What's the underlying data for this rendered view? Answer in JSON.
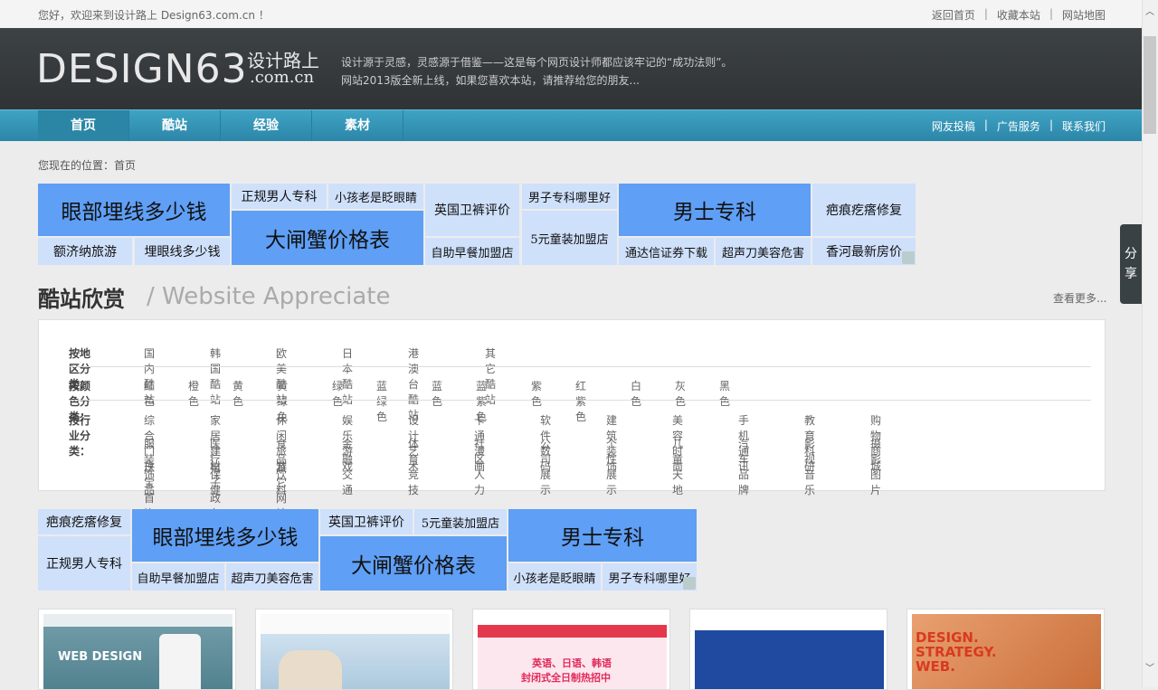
{
  "top": {
    "welcome": "您好，欢迎来到设计路上 Design63.com.cn ！",
    "links": [
      "返回首页",
      "收藏本站",
      "网站地图"
    ],
    "sep": "|"
  },
  "header": {
    "logo_main": "DESIGN63",
    "logo_cn": "设计路上",
    "logo_domain": ".com.cn",
    "slogan1": "设计源于灵感，灵感源于借鉴——这是每个网页设计师都应该牢记的“成功法则”。",
    "slogan2": "网站2013版全新上线，如果您喜欢本站，请推荐给您的朋友..."
  },
  "nav": {
    "items": [
      "首页",
      "酷站",
      "经验",
      "素材"
    ],
    "right": [
      "网友投稿",
      "广告服务",
      "联系我们"
    ]
  },
  "breadcrumb": "您现在的位置：首页",
  "ads1": {
    "a1": "眼部埋线多少钱",
    "a2": "额济纳旅游",
    "a3": "埋眼线多少钱",
    "a4": "正规男人专科",
    "a5": "小孩老是眨眼睛",
    "a6": "大闸蟹价格表",
    "a7": "英国卫裤评价",
    "a8": "自助早餐加盟店",
    "a9": "男子专科哪里好",
    "a10": "5元童装加盟店",
    "a11": "男士专科",
    "a12": "通达信证券下载",
    "a13": "超声刀美容危害",
    "a14": "疤痕疙瘩修复",
    "a15": "香河最新房价"
  },
  "section": {
    "title": "酷站欣赏",
    "subtitle": "/ Website Appreciate",
    "more": "查看更多..."
  },
  "categories": {
    "region_label": "按地区分类：",
    "region": [
      "国内酷站",
      "韩国酷站",
      "欧美酷站",
      "日本酷站",
      "港澳台酷站",
      "其它酷站"
    ],
    "color_label": "按颜色分类：",
    "color": [
      "红色",
      "橙色",
      "黄色",
      "黄绿色",
      "绿色",
      "蓝绿色",
      "蓝色",
      "蓝紫色",
      "紫色",
      "红紫色",
      "白色",
      "灰色",
      "黑色"
    ],
    "industry_label": "按行业分类：",
    "industry_row1": [
      "综合门户",
      "家居建材",
      "休闲旅游",
      "娱乐游戏",
      "设计艺术",
      "卡通漫画",
      "软件数码",
      "建筑装饰",
      "美容时尚",
      "手机通讯",
      "教育科研",
      "购物商城"
    ],
    "industry_row2": [
      "服装饰品",
      "医疗保健",
      "食品饮料",
      "金融交通",
      "体育竞技",
      "社区人力",
      "公司展示",
      "个性展示",
      "儿童天地",
      "汽车品牌",
      "影视音乐",
      "摄影图片"
    ],
    "industry_row3": [
      "珠宝首饰",
      "电子政务",
      "其它网站"
    ]
  },
  "ads2": {
    "b1": "疤痕疙瘩修复",
    "b2": "正规男人专科",
    "b3": "眼部埋线多少钱",
    "b4": "自助早餐加盟店",
    "b5": "超声刀美容危害",
    "b6": "英国卫裤评价",
    "b7": "5元童装加盟店",
    "b8": "大闸蟹价格表",
    "b9": "男士专科",
    "b10": "小孩老是眨眼睛",
    "b11": "男子专科哪里好"
  },
  "thumbs": {
    "t1": "WEB DESIGN",
    "t3": "英语、日语、韩语",
    "t3b": "封闭式全日制热招中",
    "t5": "DESIGN. STRATEGY. WEB."
  },
  "share": [
    "分",
    "享"
  ],
  "colors": {
    "nav": "#3fa3c4",
    "header": "#3d4245",
    "ad_big": "#5f9ff5",
    "ad_small": "#cfe0fb"
  }
}
